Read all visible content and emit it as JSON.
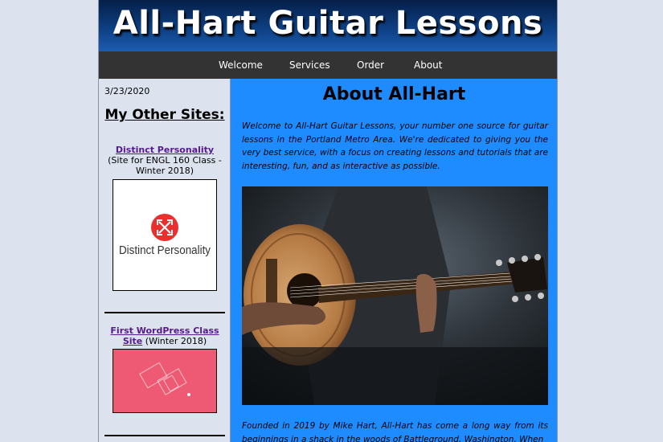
{
  "header": {
    "title": "All-Hart Guitar Lessons"
  },
  "nav": {
    "items": [
      "Welcome",
      "Services",
      "Order",
      "About"
    ]
  },
  "sidebar": {
    "date": "3/23/2020",
    "heading": "My Other Sites:",
    "sites": [
      {
        "link": "Distinct Personality",
        "note": "(Site for ENGL 160 Class - Winter 2018)",
        "logo_text": "Distinct Personality"
      },
      {
        "link": "First WordPress Class Site",
        "note": "(Winter 2018)"
      }
    ]
  },
  "main": {
    "title": "About All-Hart",
    "intro": "Welcome to All-Hart Guitar Lessons, your number one source for guitar lessons in the Portland Metro Area. We're dedicated to giving you the very best service, with a focus on creating lessons and tutorials that are interesting, fun, and as interactive as possible.",
    "story": "Founded in 2019 by Mike Hart, All-Hart has come a long way from its beginnings in a shack in the woods of Battleground, Washington. When"
  },
  "colors": {
    "page_bg": "#dce3ef",
    "content_bg": "#1e8cff",
    "nav_bg": "#333333",
    "link": "#551a8b"
  }
}
